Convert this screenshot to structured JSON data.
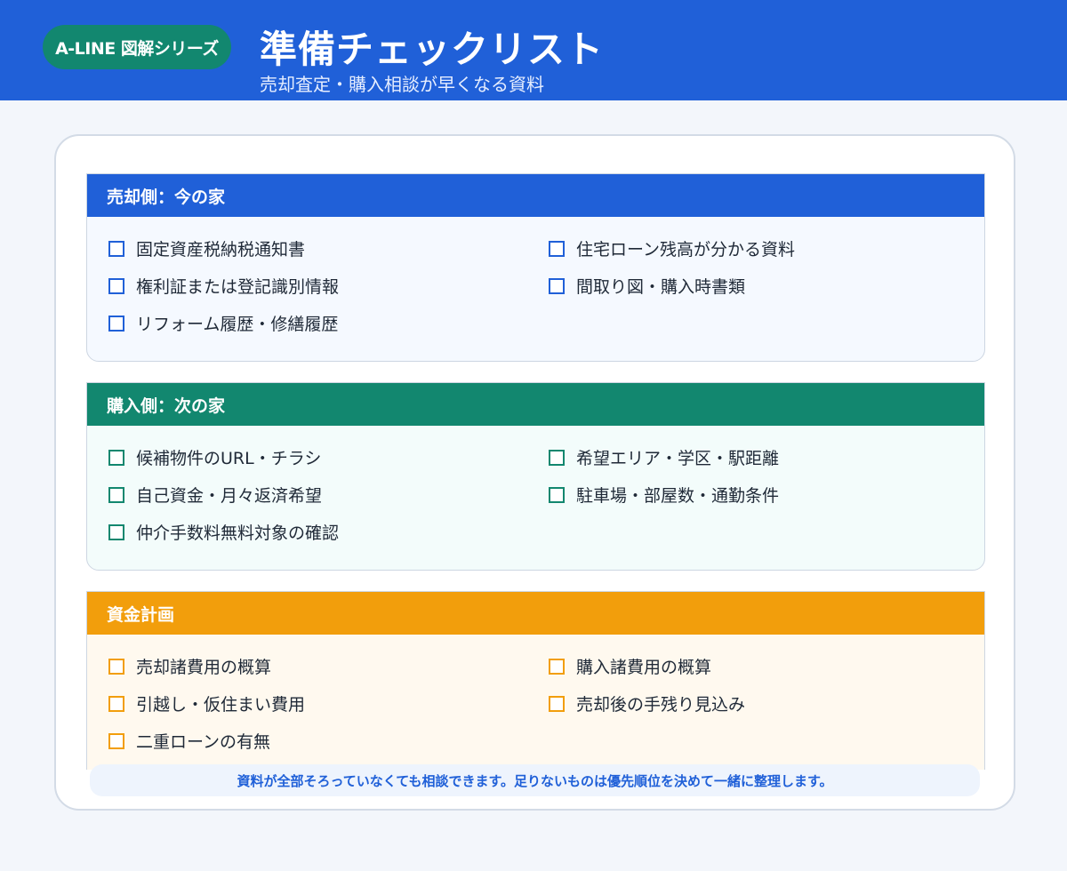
{
  "header": {
    "badge": "A-LINE 図解シリーズ",
    "title": "準備チェックリスト",
    "subtitle": "売却査定・購入相談が早くなる資料"
  },
  "sections": [
    {
      "title": "売却側：今の家",
      "color": "#2060d8",
      "items": [
        "固定資産税納税通知書",
        "住宅ローン残高が分かる資料",
        "権利証または登記識別情報",
        "間取り図・購入時書類",
        "リフォーム履歴・修繕履歴"
      ]
    },
    {
      "title": "購入側：次の家",
      "color": "#12876f",
      "items": [
        "候補物件のURL・チラシ",
        "希望エリア・学区・駅距離",
        "自己資金・月々返済希望",
        "駐車場・部屋数・通勤条件",
        "仲介手数料無料対象の確認"
      ]
    },
    {
      "title": "資金計画",
      "color": "#f29e0c",
      "items": [
        "売却諸費用の概算",
        "購入諸費用の概算",
        "引越し・仮住まい費用",
        "売却後の手残り見込み",
        "二重ローンの有無"
      ]
    }
  ],
  "footer_note": "資料が全部そろっていなくても相談できます。足りないものは優先順位を決めて一緒に整理します。"
}
